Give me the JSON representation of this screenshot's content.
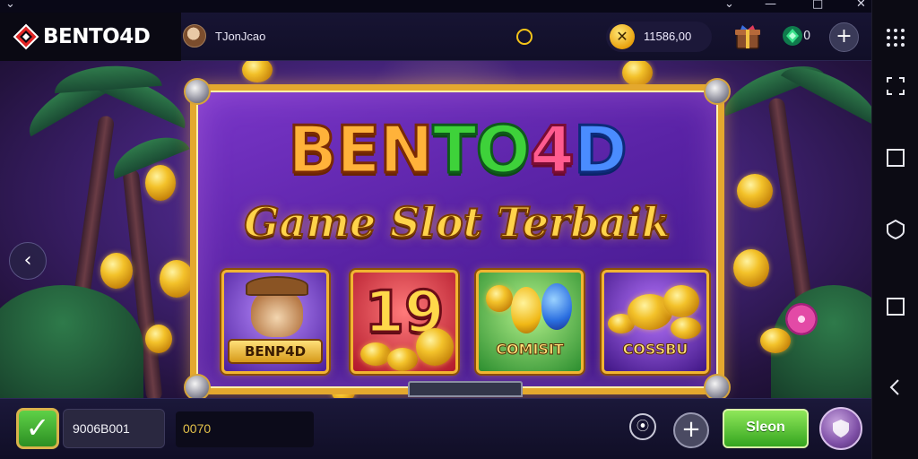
{
  "header": {
    "logo_text": "BENTO4D",
    "username": "TJonJcao",
    "coin_balance": "11586,00",
    "coin_symbol": "✕",
    "gem_count": "0",
    "add_label": "+"
  },
  "banner": {
    "title_parts": [
      "BEN",
      "TO",
      "4",
      "D"
    ],
    "subtitle": "Game Slot Terbaik",
    "tiles": [
      {
        "caption": "BENP4D"
      },
      {
        "big_text": "19"
      },
      {
        "caption": "COMISIT"
      },
      {
        "caption": "COSSBU"
      }
    ]
  },
  "navigation": {
    "prev_label": "‹"
  },
  "footer": {
    "check_label": "✓",
    "balance": "9006B001",
    "bet": "0070",
    "info_label": "⦿",
    "add_label": "+",
    "spin_label": "Sleon"
  },
  "colors": {
    "accent_gold": "#e4a82e",
    "panel_purple": "#5a23a6",
    "spin_green": "#34a51f"
  },
  "icons": {
    "sidebar": [
      "grid-icon",
      "screenshot-icon",
      "square-icon",
      "shield-icon",
      "square-icon",
      "back-icon"
    ],
    "header": [
      "bento-logo-icon",
      "avatar",
      "bell-icon",
      "coin-icon",
      "gift-icon",
      "gem-icon",
      "plus-icon"
    ]
  }
}
